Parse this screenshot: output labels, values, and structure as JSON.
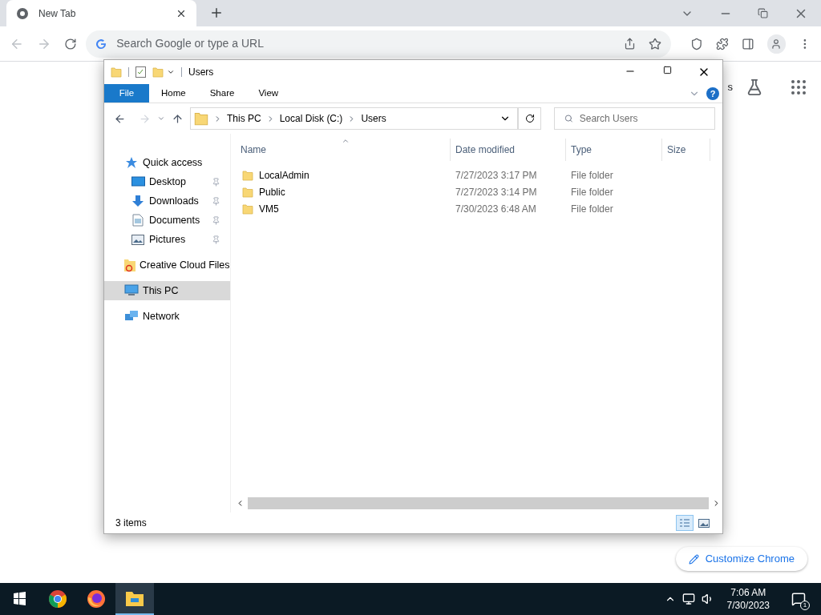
{
  "browser": {
    "tabs": [
      {
        "title": "New Tab",
        "selected": true
      }
    ],
    "omnibox": {
      "placeholder": "Search Google or type a URL"
    },
    "page": {
      "partial_link": "s",
      "customize_button": "Customize Chrome"
    }
  },
  "explorer": {
    "title": "Users",
    "ribbon_tabs": [
      {
        "label": "File",
        "selected": true
      },
      {
        "label": "Home",
        "selected": false
      },
      {
        "label": "Share",
        "selected": false
      },
      {
        "label": "View",
        "selected": false
      }
    ],
    "help_button": "?",
    "breadcrumbs": [
      "This PC",
      "Local Disk (C:)",
      "Users"
    ],
    "search": {
      "placeholder": "Search Users"
    },
    "nav": [
      {
        "label": "Quick access",
        "kind": "quick",
        "selected": false,
        "children": [
          {
            "label": "Desktop",
            "kind": "desktop",
            "selected": false,
            "pinned": true
          },
          {
            "label": "Downloads",
            "kind": "downloads",
            "selected": false,
            "pinned": true
          },
          {
            "label": "Documents",
            "kind": "documents",
            "selected": false,
            "pinned": true
          },
          {
            "label": "Pictures",
            "kind": "pictures",
            "selected": false,
            "pinned": true
          }
        ]
      },
      {
        "label": "Creative Cloud Files",
        "kind": "cloud",
        "selected": false
      },
      {
        "label": "This PC",
        "kind": "pc",
        "selected": true
      },
      {
        "label": "Network",
        "kind": "network",
        "selected": false
      }
    ],
    "columns": [
      "Name",
      "Date modified",
      "Type",
      "Size"
    ],
    "rows": [
      {
        "name": "LocalAdmin",
        "date": "7/27/2023 3:17 PM",
        "type": "File folder"
      },
      {
        "name": "Public",
        "date": "7/27/2023 3:14 PM",
        "type": "File folder"
      },
      {
        "name": "VM5",
        "date": "7/30/2023 6:48 AM",
        "type": "File folder"
      }
    ],
    "status": "3 items"
  },
  "taskbar": {
    "apps": [
      {
        "kind": "chrome",
        "selected": false
      },
      {
        "kind": "firefox",
        "selected": false
      },
      {
        "kind": "explorer",
        "selected": true
      }
    ],
    "time": "7:06 AM",
    "date": "7/30/2023",
    "notifications": "1"
  }
}
